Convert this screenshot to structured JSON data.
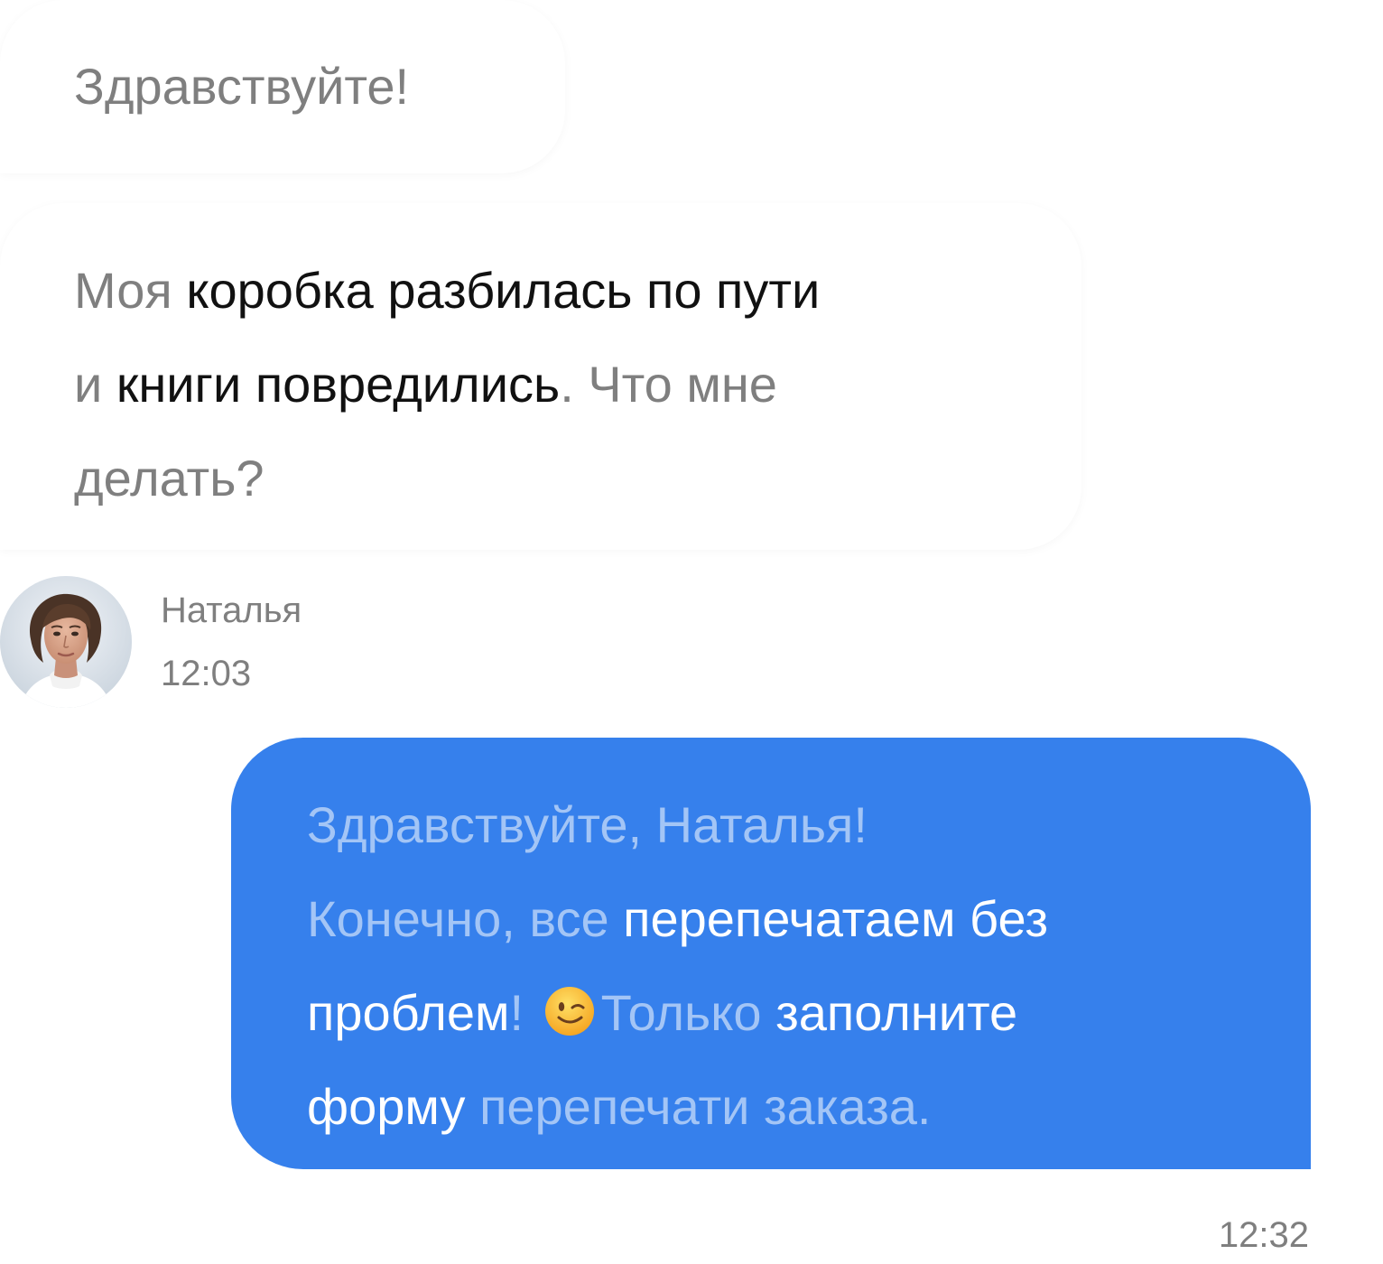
{
  "incoming_messages": [
    {
      "segments": [
        {
          "text": "Здравствуйте!",
          "style": "dim"
        }
      ]
    },
    {
      "lines": [
        [
          {
            "text": "Моя ",
            "style": "dim"
          },
          {
            "text": "коробка разбилась по пути",
            "style": "strong"
          }
        ],
        [
          {
            "text": "и ",
            "style": "dim"
          },
          {
            "text": "книги повредились",
            "style": "strong"
          },
          {
            "text": ". Что мне",
            "style": "dim"
          }
        ],
        [
          {
            "text": "делать?",
            "style": "dim"
          }
        ]
      ]
    }
  ],
  "sender": {
    "name": "Наталья",
    "time": "12:03",
    "avatar_icon": "avatar-woman"
  },
  "outgoing_message": {
    "lines": [
      [
        {
          "text": "Здравствуйте, Наталья!",
          "style": "light"
        }
      ],
      [
        {
          "text": "Конечно, все ",
          "style": "light"
        },
        {
          "text": "перепечатаем без",
          "style": "white"
        }
      ],
      [
        {
          "text": "проблем",
          "style": "white"
        },
        {
          "text": "!",
          "style": "light"
        },
        {
          "text": "😉",
          "style": "emoji"
        },
        {
          "text": "Только ",
          "style": "light"
        },
        {
          "text": "заполните",
          "style": "white"
        }
      ],
      [
        {
          "text": "форму ",
          "style": "white"
        },
        {
          "text": "перепечати заказа.",
          "style": "light"
        }
      ]
    ],
    "time": "12:32",
    "background_color": "#3680ec"
  }
}
